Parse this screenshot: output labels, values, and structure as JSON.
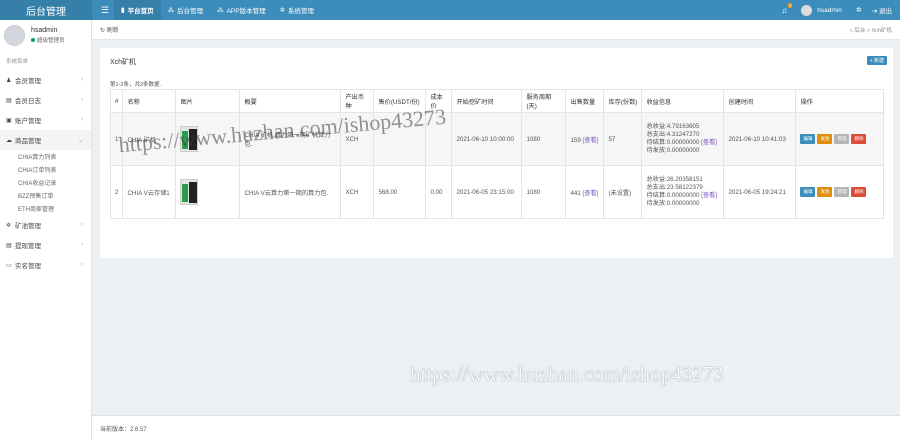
{
  "header": {
    "logo": "后台管理",
    "nav": [
      {
        "label": "平台首页",
        "icon": "bookmark-icon",
        "active": true
      },
      {
        "label": "后台管理",
        "icon": "sitemap-icon",
        "active": false
      },
      {
        "label": "APP版本管理",
        "icon": "sitemap-icon",
        "active": false
      },
      {
        "label": "系统管理",
        "icon": "gears-icon",
        "active": false
      }
    ],
    "notification_count": "1",
    "username": "hsadmin",
    "logout": "退出"
  },
  "sidebar": {
    "user": {
      "name": "hsadmin",
      "role": "超级管理员"
    },
    "section_label": "系统菜单",
    "items": [
      {
        "label": "会员管理",
        "icon": "user-icon"
      },
      {
        "label": "会员日志",
        "icon": "list-icon"
      },
      {
        "label": "账户管理",
        "icon": "wallet-icon"
      },
      {
        "label": "商品管理",
        "icon": "cloud-icon",
        "open": true,
        "children": [
          "CHIA算力列表",
          "CHIA订单列表",
          "CHIA收益记录",
          "BZZ预售订单",
          "ETH商家管理"
        ]
      },
      {
        "label": "矿池管理",
        "icon": "gear-icon"
      },
      {
        "label": "提现管理",
        "icon": "list-icon"
      },
      {
        "label": "实名管理",
        "icon": "id-card-icon"
      }
    ]
  },
  "breadcrumb": {
    "refresh": "刷新",
    "crumbs": "后台 > Xch矿机"
  },
  "panel": {
    "title": "Xch矿机",
    "add_button": "+ 新建",
    "summary": "第1-2条，共2条数据.",
    "columns": [
      "#",
      "名称",
      "图片",
      "概要",
      "产出币种",
      "售价(USDT/份)",
      "成本价",
      "开始挖矿时间",
      "服务周期(天)",
      "出售数量",
      "库存(份数)",
      "收益信息",
      "创建时间",
      "操作"
    ],
    "rows": [
      {
        "index": "1",
        "name": "CHIA 矿机",
        "summary": "CHIA 矿机,算力第一期矿机算力包.",
        "coin": "XCH",
        "price": "",
        "cost": "",
        "start_time": "2021-06-10 10:00:00",
        "period": "1080",
        "sold": "159",
        "sold_link": "[查看]",
        "stock": "57",
        "income": [
          "总收益:4.79163605",
          "总支出:4.31247270",
          "待结算:0.00000000",
          "待发放:0.00000000"
        ],
        "income_link": "[查看]",
        "created": "2021-06-10 10:41:03"
      },
      {
        "index": "2",
        "name": "CHIA V云存储1",
        "summary": "CHIA V云算力第一期的算力包.",
        "coin": "XCH",
        "price": "568.00",
        "cost": "0.00",
        "start_time": "2021-06-05 23:15:00",
        "period": "1080",
        "sold": "441",
        "sold_link": "[查看]",
        "stock": "(未设置)",
        "income": [
          "总收益:26.20358151",
          "总支出:23.58122379",
          "待结算:0.00000000",
          "待发放:0.00000000"
        ],
        "income_link": "[查看]",
        "created": "2021-06-05 19:24:21"
      }
    ],
    "ops": {
      "edit": "编辑",
      "ship": "发放",
      "manage": "管理",
      "delete": "删除"
    }
  },
  "footer": {
    "version": "当前版本：2.6.57"
  },
  "watermark": "https://www.huzhan.com/ishop43273"
}
